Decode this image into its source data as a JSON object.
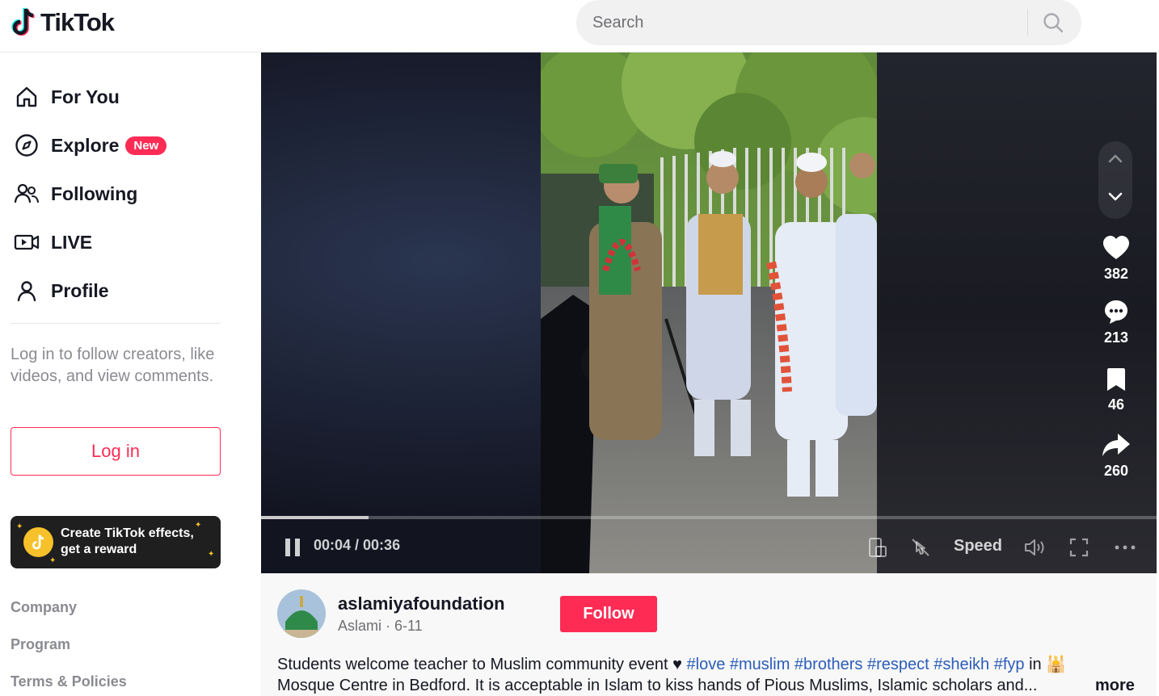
{
  "header": {
    "logo_text": "TikTok",
    "search_placeholder": "Search"
  },
  "sidebar": {
    "nav": [
      {
        "label": "For You",
        "icon": "home-icon"
      },
      {
        "label": "Explore",
        "icon": "compass-icon",
        "badge": "New"
      },
      {
        "label": "Following",
        "icon": "following-icon"
      },
      {
        "label": "LIVE",
        "icon": "live-icon"
      },
      {
        "label": "Profile",
        "icon": "profile-icon"
      }
    ],
    "login_prompt": "Log in to follow creators, like videos, and view comments.",
    "login_button": "Log in",
    "effects_banner": {
      "line1": "Create TikTok effects,",
      "line2": "get a reward"
    },
    "footer_links": [
      "Company",
      "Program",
      "Terms & Policies"
    ]
  },
  "video": {
    "time": "00:04 / 00:36",
    "speed_label": "Speed",
    "progress": 0.12,
    "actions": {
      "likes": "382",
      "comments": "213",
      "saves": "46",
      "shares": "260"
    }
  },
  "post": {
    "username": "aslamiyafoundation",
    "subline": "Aslami · 6-11",
    "follow_button": "Follow",
    "desc_text": "Students welcome teacher to Muslim community event ♥ ",
    "hashtags": "#love #muslim #brothers #respect #sheikh #fyp",
    "desc_after": " in 🕌",
    "desc_line2": "Mosque Centre in Bedford. It is acceptable in Islam to kiss hands of Pious Muslims, Islamic scholars and...",
    "more": "more"
  },
  "colors": {
    "brand_red": "#fe2c55",
    "hashtag_blue": "#2b5db9",
    "muted_gray": "#8a8b91"
  }
}
